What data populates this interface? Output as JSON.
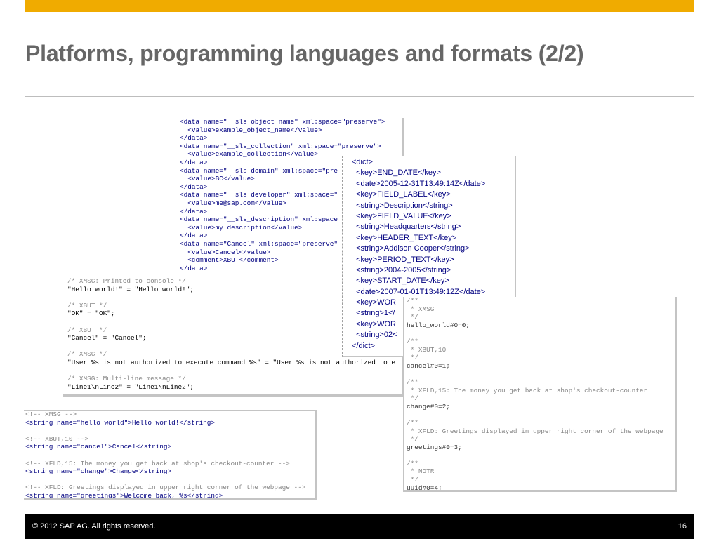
{
  "title": "Platforms, programming languages and formats (2/2)",
  "footer": {
    "copyright": "©  2012 SAP AG. All rights reserved.",
    "page": "16"
  },
  "colors": {
    "accent": "#f0ab00",
    "title": "#666666",
    "footer_bg": "#000000",
    "tag": "#000080",
    "attr_value": "#008000",
    "comment": "#888888"
  },
  "xml_data_lines": [
    "<data name=\"__sls_object_name\" xml:space=\"preserve\">",
    "  <value>example_object_name</value>",
    "</data>",
    "<data name=\"__sls_collection\" xml:space=\"preserve\">",
    "  <value>example_collection</value>",
    "</data>",
    "<data name=\"__sls_domain\" xml:space=\"pre",
    "  <value>BC</value>",
    "</data>",
    "<data name=\"__sls_developer\" xml:space=\"",
    "  <value>me@sap.com</value>",
    "</data>",
    "<data name=\"__sls_description\" xml:space",
    "  <value>my description</value>",
    "</data>",
    "<data name=\"Cancel\" xml:space=\"preserve\"",
    "  <value>Cancel</value>",
    "  <comment>XBUT</comment>",
    "</data>"
  ],
  "strings_lines": [
    "/* XMSG: Printed to console */",
    "\"Hello world!\" = \"Hello world!\";",
    "",
    "/* XBUT */",
    "\"OK\" = \"OK\";",
    "",
    "/* XBUT */",
    "\"Cancel\" = \"Cancel\";",
    "",
    "/* XMSG */",
    "\"User %s is not authorized to execute command %s\" = \"User %s is not authorized to e",
    "",
    "/* XMSG: Multi-line message */",
    "\"Line1\\nLine2\" = \"Line1\\nLine2\";"
  ],
  "plist_lines": [
    "<dict>",
    "  <key>END_DATE</key>",
    "  <date>2005-12-31T13:49:14Z</date>",
    "  <key>FIELD_LABEL</key>",
    "  <string>Description</string>",
    "  <key>FIELD_VALUE</key>",
    "  <string>Headquarters</string>",
    "  <key>HEADER_TEXT</key>",
    "  <string>Addison Cooper</string>",
    "  <key>PERIOD_TEXT</key>",
    "  <string>2004-2005</string>",
    "  <key>START_DATE</key>",
    "  <date>2007-01-01T13:49:12Z</date>",
    "  <key>WOR",
    "  <string>1</",
    "  <key>WOR",
    "  <string>02<",
    "</dict>"
  ],
  "android_lines": [
    "<!-- XMSG -->",
    "<string name=\"hello_world\">Hello world!</string>",
    "",
    "<!-- XBUT,10 -->",
    "<string name=\"cancel\">Cancel</string>",
    "",
    "<!-- XFLD,15: The money you get back at shop's checkout-counter -->",
    "<string name=\"change\">Change</string>",
    "",
    "<!-- XFLD: Greetings displayed in upper right corner of the webpage -->",
    "<string name=\"greetings\">Welcome back, %s</string>"
  ],
  "properties_lines": [
    "/**",
    " * XMSG",
    " */",
    "hello_world#0=0;",
    "",
    "/**",
    " * XBUT,10",
    " */",
    "cancel#0=1;",
    "",
    "/**",
    " * XFLD,15: The money you get back at shop's checkout-counter",
    " */",
    "change#0=2;",
    "",
    "/**",
    " * XFLD: Greetings displayed in upper right corner of the webpage",
    " */",
    "greetings#0=3;",
    "",
    "/**",
    " * NOTR",
    " */",
    "uuid#0=4;"
  ]
}
